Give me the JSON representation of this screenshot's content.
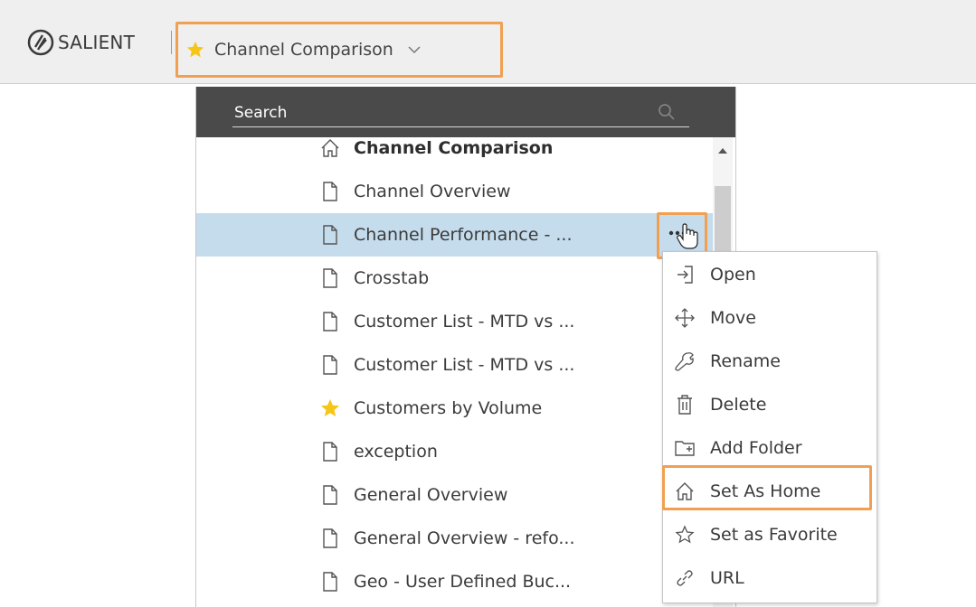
{
  "header": {
    "brand": "SALIENT",
    "current_dashboard": "Channel Comparison"
  },
  "search": {
    "placeholder": "Search"
  },
  "dashboard_list": [
    {
      "label": "Channel Comparison",
      "icon": "home-icon",
      "bold": true
    },
    {
      "label": "Channel Overview",
      "icon": "document-icon"
    },
    {
      "label": "Channel Performance - ...",
      "icon": "document-icon",
      "selected": true
    },
    {
      "label": "Crosstab",
      "icon": "document-icon"
    },
    {
      "label": "Customer List - MTD vs ...",
      "icon": "document-icon"
    },
    {
      "label": "Customer List - MTD vs ...",
      "icon": "document-icon"
    },
    {
      "label": "Customers by Volume",
      "icon": "star-icon"
    },
    {
      "label": "exception",
      "icon": "document-icon"
    },
    {
      "label": "General Overview",
      "icon": "document-icon"
    },
    {
      "label": "General Overview - refo...",
      "icon": "document-icon"
    },
    {
      "label": "Geo - User Defined Buc...",
      "icon": "document-icon"
    }
  ],
  "context_menu": [
    {
      "label": "Open",
      "icon": "open-icon"
    },
    {
      "label": "Move",
      "icon": "move-icon"
    },
    {
      "label": "Rename",
      "icon": "wrench-icon"
    },
    {
      "label": "Delete",
      "icon": "trash-icon"
    },
    {
      "label": "Add Folder",
      "icon": "folder-add-icon"
    },
    {
      "label": "Set As Home",
      "icon": "home-icon",
      "highlighted": true
    },
    {
      "label": "Set as Favorite",
      "icon": "star-outline-icon"
    },
    {
      "label": "URL",
      "icon": "link-icon"
    }
  ],
  "colors": {
    "highlight_border": "#f0a050",
    "selected_row": "#c5dced",
    "search_bar": "#4a4a4a",
    "favorite_star": "#f5c518"
  }
}
